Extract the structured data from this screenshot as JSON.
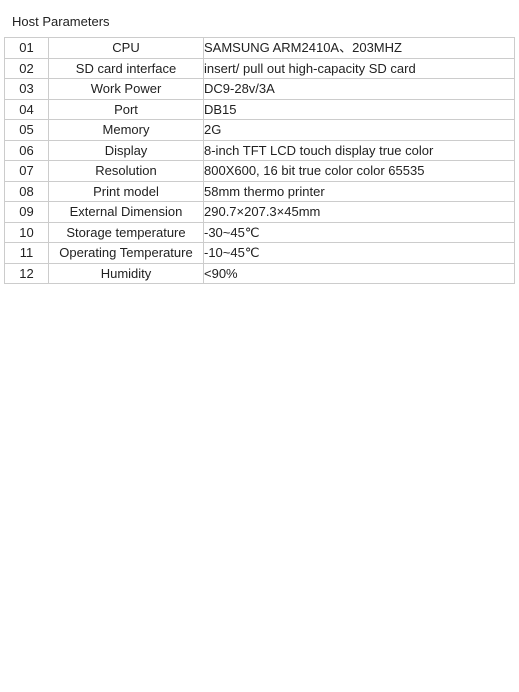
{
  "header": {
    "title": "Host Parameters"
  },
  "table": {
    "rows": [
      {
        "num": "01",
        "label": "CPU",
        "value": "SAMSUNG ARM2410A、203MHZ"
      },
      {
        "num": "02",
        "label": "SD card interface",
        "value": "insert/ pull out high-capacity SD card"
      },
      {
        "num": "03",
        "label": "Work Power",
        "value": "DC9-28v/3A"
      },
      {
        "num": "04",
        "label": "Port",
        "value": "DB15"
      },
      {
        "num": "05",
        "label": "Memory",
        "value": "2G"
      },
      {
        "num": "06",
        "label": "Display",
        "value": "8-inch TFT   LCD touch display true color"
      },
      {
        "num": "07",
        "label": "Resolution",
        "value": "800X600, 16 bit true color  color 65535"
      },
      {
        "num": "08",
        "label": "Print model",
        "value": "58mm thermo printer"
      },
      {
        "num": "09",
        "label": "External Dimension",
        "value": "290.7×207.3×45mm"
      },
      {
        "num": "10",
        "label": "Storage temperature",
        "value": "-30~45℃"
      },
      {
        "num": "11",
        "label": "Operating Temperature",
        "value": "-10~45℃"
      },
      {
        "num": "12",
        "label": "Humidity",
        "value": "<90%"
      }
    ]
  }
}
